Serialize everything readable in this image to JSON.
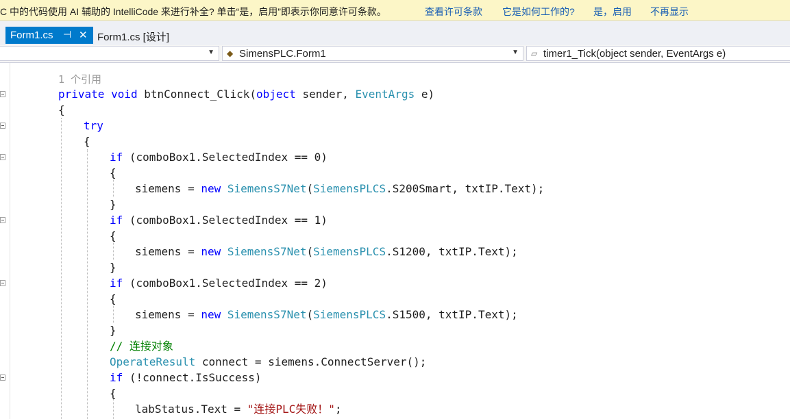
{
  "infobar": {
    "message": "C 中的代码使用 AI 辅助的 IntelliCode 来进行补全? 单击“是，启用”即表示你同意许可条款。",
    "link_license": "查看许可条款",
    "link_how": "它是如何工作的?",
    "link_enable": "是，启用",
    "link_dismiss": "不再显示"
  },
  "tabs": {
    "active_label": "Form1.cs",
    "pin_icon": "pin-icon",
    "close_icon": "close-icon",
    "inactive_label": "Form1.cs [设计]"
  },
  "navbar": {
    "project_value": "",
    "class_value": "SimensPLC.Form1",
    "member_value": "timer1_Tick(object sender, EventArgs e)"
  },
  "code": {
    "ref_count": "1 个引用",
    "l1": {
      "kw1": "private",
      "kw2": "void",
      "name": "btnConnect_Click(",
      "kw3": "object",
      "mid": " sender, ",
      "type": "EventArgs",
      "end": " e)"
    },
    "l2": "{",
    "l3": "try",
    "l4": "{",
    "if0": {
      "kw": "if",
      "rest": " (comboBox1.SelectedIndex == 0)"
    },
    "b0o": "{",
    "s0": {
      "pre": "siemens = ",
      "kw": "new",
      "sp": " ",
      "t1": "SiemensS7Net",
      "p": "(",
      "t2": "SiemensPLCS",
      "rest": ".S200Smart, txtIP.Text);"
    },
    "b0c": "}",
    "if1": {
      "kw": "if",
      "rest": " (comboBox1.SelectedIndex == 1)"
    },
    "b1o": "{",
    "s1": {
      "pre": "siemens = ",
      "kw": "new",
      "sp": " ",
      "t1": "SiemensS7Net",
      "p": "(",
      "t2": "SiemensPLCS",
      "rest": ".S1200, txtIP.Text);"
    },
    "b1c": "}",
    "if2": {
      "kw": "if",
      "rest": " (comboBox1.SelectedIndex == 2)"
    },
    "b2o": "{",
    "s2": {
      "pre": "siemens = ",
      "kw": "new",
      "sp": " ",
      "t1": "SiemensS7Net",
      "p": "(",
      "t2": "SiemensPLCS",
      "rest": ".S1500, txtIP.Text);"
    },
    "b2c": "}",
    "comment": "// 连接对象",
    "op": {
      "type": "OperateResult",
      "rest": " connect = siemens.ConnectServer();"
    },
    "if3": {
      "kw": "if",
      "rest": " (!connect.IsSuccess)"
    },
    "b3o": "{",
    "lab": {
      "pre": "labStatus.Text = ",
      "str": "\"连接PLC失败！\"",
      "end": ";"
    }
  },
  "colors": {
    "accent": "#007acc",
    "keyword": "#0000ff",
    "type": "#2b91af",
    "comment": "#008000",
    "string": "#a31515"
  }
}
